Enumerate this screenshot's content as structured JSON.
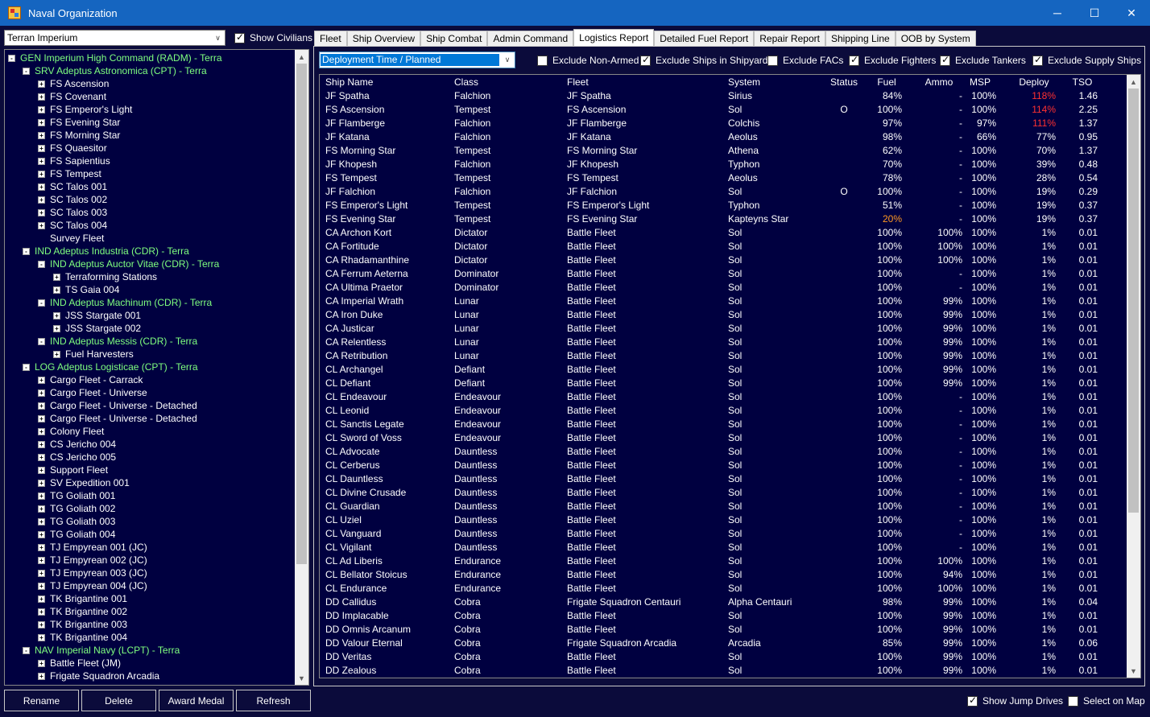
{
  "window": {
    "title": "Naval Organization"
  },
  "race_combo": {
    "value": "Terran Imperium"
  },
  "show_civilians": {
    "label": "Show Civilians",
    "checked": true
  },
  "tree": [
    {
      "label": "GEN Imperium High Command  (RADM)  -  Terra",
      "level": 0,
      "exp": "-",
      "color": "green"
    },
    {
      "label": "SRV Adeptus Astronomica  (CPT)  -  Terra",
      "level": 1,
      "exp": "-",
      "color": "green"
    },
    {
      "label": "FS Ascension",
      "level": 2,
      "exp": "+",
      "color": "white"
    },
    {
      "label": "FS Covenant",
      "level": 2,
      "exp": "+",
      "color": "white"
    },
    {
      "label": "FS Emperor's Light",
      "level": 2,
      "exp": "+",
      "color": "white"
    },
    {
      "label": "FS Evening Star",
      "level": 2,
      "exp": "+",
      "color": "white"
    },
    {
      "label": "FS Morning Star",
      "level": 2,
      "exp": "+",
      "color": "white"
    },
    {
      "label": "FS Quaesitor",
      "level": 2,
      "exp": "+",
      "color": "white"
    },
    {
      "label": "FS Sapientius",
      "level": 2,
      "exp": "+",
      "color": "white"
    },
    {
      "label": "FS Tempest",
      "level": 2,
      "exp": "+",
      "color": "white"
    },
    {
      "label": "SC Talos 001",
      "level": 2,
      "exp": "+",
      "color": "white"
    },
    {
      "label": "SC Talos 002",
      "level": 2,
      "exp": "+",
      "color": "white"
    },
    {
      "label": "SC Talos 003",
      "level": 2,
      "exp": "+",
      "color": "white"
    },
    {
      "label": "SC Talos 004",
      "level": 2,
      "exp": "+",
      "color": "white"
    },
    {
      "label": "Survey Fleet",
      "level": 2,
      "exp": "",
      "color": "white"
    },
    {
      "label": "IND Adeptus Industria  (CDR)  -  Terra",
      "level": 1,
      "exp": "-",
      "color": "green"
    },
    {
      "label": "IND Adeptus Auctor Vitae  (CDR)  -  Terra",
      "level": 2,
      "exp": "-",
      "color": "green"
    },
    {
      "label": "Terraforming Stations",
      "level": 3,
      "exp": "+",
      "color": "white"
    },
    {
      "label": "TS Gaia 004",
      "level": 3,
      "exp": "+",
      "color": "white"
    },
    {
      "label": "IND Adeptus Machinum  (CDR)  -  Terra",
      "level": 2,
      "exp": "-",
      "color": "green"
    },
    {
      "label": "JSS Stargate 001",
      "level": 3,
      "exp": "+",
      "color": "white"
    },
    {
      "label": "JSS Stargate 002",
      "level": 3,
      "exp": "+",
      "color": "white"
    },
    {
      "label": "IND Adeptus Messis  (CDR)  -  Terra",
      "level": 2,
      "exp": "-",
      "color": "green"
    },
    {
      "label": "Fuel Harvesters",
      "level": 3,
      "exp": "+",
      "color": "white"
    },
    {
      "label": "LOG Adeptus Logisticae  (CPT)  -  Terra",
      "level": 1,
      "exp": "-",
      "color": "green"
    },
    {
      "label": "Cargo Fleet - Carrack",
      "level": 2,
      "exp": "+",
      "color": "white"
    },
    {
      "label": "Cargo Fleet - Universe",
      "level": 2,
      "exp": "+",
      "color": "white"
    },
    {
      "label": "Cargo Fleet - Universe - Detached",
      "level": 2,
      "exp": "+",
      "color": "white"
    },
    {
      "label": "Cargo Fleet - Universe - Detached",
      "level": 2,
      "exp": "+",
      "color": "white"
    },
    {
      "label": "Colony Fleet",
      "level": 2,
      "exp": "+",
      "color": "white"
    },
    {
      "label": "CS Jericho 004",
      "level": 2,
      "exp": "+",
      "color": "white"
    },
    {
      "label": "CS Jericho 005",
      "level": 2,
      "exp": "+",
      "color": "white"
    },
    {
      "label": "Support Fleet",
      "level": 2,
      "exp": "+",
      "color": "white"
    },
    {
      "label": "SV Expedition 001",
      "level": 2,
      "exp": "+",
      "color": "white"
    },
    {
      "label": "TG Goliath 001",
      "level": 2,
      "exp": "+",
      "color": "white"
    },
    {
      "label": "TG Goliath 002",
      "level": 2,
      "exp": "+",
      "color": "white"
    },
    {
      "label": "TG Goliath 003",
      "level": 2,
      "exp": "+",
      "color": "white"
    },
    {
      "label": "TG Goliath 004",
      "level": 2,
      "exp": "+",
      "color": "white"
    },
    {
      "label": "TJ Empyrean 001  (JC)",
      "level": 2,
      "exp": "+",
      "color": "white"
    },
    {
      "label": "TJ Empyrean 002  (JC)",
      "level": 2,
      "exp": "+",
      "color": "white"
    },
    {
      "label": "TJ Empyrean 003  (JC)",
      "level": 2,
      "exp": "+",
      "color": "white"
    },
    {
      "label": "TJ Empyrean 004  (JC)",
      "level": 2,
      "exp": "+",
      "color": "white"
    },
    {
      "label": "TK Brigantine 001",
      "level": 2,
      "exp": "+",
      "color": "white"
    },
    {
      "label": "TK Brigantine 002",
      "level": 2,
      "exp": "+",
      "color": "white"
    },
    {
      "label": "TK Brigantine 003",
      "level": 2,
      "exp": "+",
      "color": "white"
    },
    {
      "label": "TK Brigantine 004",
      "level": 2,
      "exp": "+",
      "color": "white"
    },
    {
      "label": "NAV Imperial Navy  (LCPT)  -  Terra",
      "level": 1,
      "exp": "-",
      "color": "green"
    },
    {
      "label": "Battle Fleet  (JM)",
      "level": 2,
      "exp": "+",
      "color": "white"
    },
    {
      "label": "Frigate Squadron Arcadia",
      "level": 2,
      "exp": "+",
      "color": "white"
    }
  ],
  "buttons": {
    "rename": "Rename",
    "delete": "Delete",
    "award_medal": "Award Medal",
    "refresh": "Refresh"
  },
  "tabs": [
    {
      "label": "Fleet",
      "active": false
    },
    {
      "label": "Ship Overview",
      "active": false
    },
    {
      "label": "Ship Combat",
      "active": false
    },
    {
      "label": "Admin Command",
      "active": false
    },
    {
      "label": "Logistics Report",
      "active": true
    },
    {
      "label": "Detailed Fuel Report",
      "active": false
    },
    {
      "label": "Repair Report",
      "active": false
    },
    {
      "label": "Shipping Line",
      "active": false
    },
    {
      "label": "OOB by System",
      "active": false
    }
  ],
  "report_combo": {
    "value": "Deployment Time / Planned"
  },
  "filters": [
    {
      "label": "Exclude Non-Armed",
      "checked": false
    },
    {
      "label": "Exclude Ships in Shipyard",
      "checked": true
    },
    {
      "label": "Exclude FACs",
      "checked": false
    },
    {
      "label": "Exclude Fighters",
      "checked": true
    },
    {
      "label": "Exclude Tankers",
      "checked": true
    },
    {
      "label": "Exclude Supply Ships",
      "checked": true
    }
  ],
  "columns": [
    "Ship Name",
    "Class",
    "Fleet",
    "System",
    "Status",
    "Fuel",
    "Ammo",
    "MSP",
    "Deploy",
    "TSO"
  ],
  "rows": [
    [
      "JF Spatha",
      "Falchion",
      "JF Spatha",
      "Sirius",
      "",
      "84%",
      "-",
      "100%",
      "118%",
      "1.46"
    ],
    [
      "FS Ascension",
      "Tempest",
      "FS Ascension",
      "Sol",
      "O",
      "100%",
      "-",
      "100%",
      "114%",
      "2.25"
    ],
    [
      "JF Flamberge",
      "Falchion",
      "JF Flamberge",
      "Colchis",
      "",
      "97%",
      "-",
      "97%",
      "111%",
      "1.37"
    ],
    [
      "JF Katana",
      "Falchion",
      "JF Katana",
      "Aeolus",
      "",
      "98%",
      "-",
      "66%",
      "77%",
      "0.95"
    ],
    [
      "FS Morning Star",
      "Tempest",
      "FS Morning Star",
      "Athena",
      "",
      "62%",
      "-",
      "100%",
      "70%",
      "1.37"
    ],
    [
      "JF Khopesh",
      "Falchion",
      "JF Khopesh",
      "Typhon",
      "",
      "70%",
      "-",
      "100%",
      "39%",
      "0.48"
    ],
    [
      "FS Tempest",
      "Tempest",
      "FS Tempest",
      "Aeolus",
      "",
      "78%",
      "-",
      "100%",
      "28%",
      "0.54"
    ],
    [
      "JF Falchion",
      "Falchion",
      "JF Falchion",
      "Sol",
      "O",
      "100%",
      "-",
      "100%",
      "19%",
      "0.29"
    ],
    [
      "FS Emperor's Light",
      "Tempest",
      "FS Emperor's Light",
      "Typhon",
      "",
      "51%",
      "-",
      "100%",
      "19%",
      "0.37"
    ],
    [
      "FS Evening Star",
      "Tempest",
      "FS Evening Star",
      "Kapteyns Star",
      "",
      "20%",
      "-",
      "100%",
      "19%",
      "0.37"
    ],
    [
      "CA Archon Kort",
      "Dictator",
      "Battle Fleet",
      "Sol",
      "",
      "100%",
      "100%",
      "100%",
      "1%",
      "0.01"
    ],
    [
      "CA Fortitude",
      "Dictator",
      "Battle Fleet",
      "Sol",
      "",
      "100%",
      "100%",
      "100%",
      "1%",
      "0.01"
    ],
    [
      "CA Rhadamanthine",
      "Dictator",
      "Battle Fleet",
      "Sol",
      "",
      "100%",
      "100%",
      "100%",
      "1%",
      "0.01"
    ],
    [
      "CA Ferrum Aeterna",
      "Dominator",
      "Battle Fleet",
      "Sol",
      "",
      "100%",
      "-",
      "100%",
      "1%",
      "0.01"
    ],
    [
      "CA Ultima Praetor",
      "Dominator",
      "Battle Fleet",
      "Sol",
      "",
      "100%",
      "-",
      "100%",
      "1%",
      "0.01"
    ],
    [
      "CA Imperial Wrath",
      "Lunar",
      "Battle Fleet",
      "Sol",
      "",
      "100%",
      "99%",
      "100%",
      "1%",
      "0.01"
    ],
    [
      "CA Iron Duke",
      "Lunar",
      "Battle Fleet",
      "Sol",
      "",
      "100%",
      "99%",
      "100%",
      "1%",
      "0.01"
    ],
    [
      "CA Justicar",
      "Lunar",
      "Battle Fleet",
      "Sol",
      "",
      "100%",
      "99%",
      "100%",
      "1%",
      "0.01"
    ],
    [
      "CA Relentless",
      "Lunar",
      "Battle Fleet",
      "Sol",
      "",
      "100%",
      "99%",
      "100%",
      "1%",
      "0.01"
    ],
    [
      "CA Retribution",
      "Lunar",
      "Battle Fleet",
      "Sol",
      "",
      "100%",
      "99%",
      "100%",
      "1%",
      "0.01"
    ],
    [
      "CL Archangel",
      "Defiant",
      "Battle Fleet",
      "Sol",
      "",
      "100%",
      "99%",
      "100%",
      "1%",
      "0.01"
    ],
    [
      "CL Defiant",
      "Defiant",
      "Battle Fleet",
      "Sol",
      "",
      "100%",
      "99%",
      "100%",
      "1%",
      "0.01"
    ],
    [
      "CL Endeavour",
      "Endeavour",
      "Battle Fleet",
      "Sol",
      "",
      "100%",
      "-",
      "100%",
      "1%",
      "0.01"
    ],
    [
      "CL Leonid",
      "Endeavour",
      "Battle Fleet",
      "Sol",
      "",
      "100%",
      "-",
      "100%",
      "1%",
      "0.01"
    ],
    [
      "CL Sanctis Legate",
      "Endeavour",
      "Battle Fleet",
      "Sol",
      "",
      "100%",
      "-",
      "100%",
      "1%",
      "0.01"
    ],
    [
      "CL Sword of Voss",
      "Endeavour",
      "Battle Fleet",
      "Sol",
      "",
      "100%",
      "-",
      "100%",
      "1%",
      "0.01"
    ],
    [
      "CL Advocate",
      "Dauntless",
      "Battle Fleet",
      "Sol",
      "",
      "100%",
      "-",
      "100%",
      "1%",
      "0.01"
    ],
    [
      "CL Cerberus",
      "Dauntless",
      "Battle Fleet",
      "Sol",
      "",
      "100%",
      "-",
      "100%",
      "1%",
      "0.01"
    ],
    [
      "CL Dauntless",
      "Dauntless",
      "Battle Fleet",
      "Sol",
      "",
      "100%",
      "-",
      "100%",
      "1%",
      "0.01"
    ],
    [
      "CL Divine Crusade",
      "Dauntless",
      "Battle Fleet",
      "Sol",
      "",
      "100%",
      "-",
      "100%",
      "1%",
      "0.01"
    ],
    [
      "CL Guardian",
      "Dauntless",
      "Battle Fleet",
      "Sol",
      "",
      "100%",
      "-",
      "100%",
      "1%",
      "0.01"
    ],
    [
      "CL Uziel",
      "Dauntless",
      "Battle Fleet",
      "Sol",
      "",
      "100%",
      "-",
      "100%",
      "1%",
      "0.01"
    ],
    [
      "CL Vanguard",
      "Dauntless",
      "Battle Fleet",
      "Sol",
      "",
      "100%",
      "-",
      "100%",
      "1%",
      "0.01"
    ],
    [
      "CL Vigilant",
      "Dauntless",
      "Battle Fleet",
      "Sol",
      "",
      "100%",
      "-",
      "100%",
      "1%",
      "0.01"
    ],
    [
      "CL Ad Liberis",
      "Endurance",
      "Battle Fleet",
      "Sol",
      "",
      "100%",
      "100%",
      "100%",
      "1%",
      "0.01"
    ],
    [
      "CL Bellator Stoicus",
      "Endurance",
      "Battle Fleet",
      "Sol",
      "",
      "100%",
      "94%",
      "100%",
      "1%",
      "0.01"
    ],
    [
      "CL Endurance",
      "Endurance",
      "Battle Fleet",
      "Sol",
      "",
      "100%",
      "100%",
      "100%",
      "1%",
      "0.01"
    ],
    [
      "DD Callidus",
      "Cobra",
      "Frigate Squadron Centauri",
      "Alpha Centauri",
      "",
      "98%",
      "99%",
      "100%",
      "1%",
      "0.04"
    ],
    [
      "DD Implacable",
      "Cobra",
      "Battle Fleet",
      "Sol",
      "",
      "100%",
      "99%",
      "100%",
      "1%",
      "0.01"
    ],
    [
      "DD Omnis Arcanum",
      "Cobra",
      "Battle Fleet",
      "Sol",
      "",
      "100%",
      "99%",
      "100%",
      "1%",
      "0.01"
    ],
    [
      "DD Valour Eternal",
      "Cobra",
      "Frigate Squadron Arcadia",
      "Arcadia",
      "",
      "85%",
      "99%",
      "100%",
      "1%",
      "0.06"
    ],
    [
      "DD Veritas",
      "Cobra",
      "Battle Fleet",
      "Sol",
      "",
      "100%",
      "99%",
      "100%",
      "1%",
      "0.01"
    ],
    [
      "DD Zealous",
      "Cobra",
      "Battle Fleet",
      "Sol",
      "",
      "100%",
      "99%",
      "100%",
      "1%",
      "0.01"
    ]
  ],
  "highlights": {
    "deploy_red": [
      0,
      1,
      2
    ],
    "fuel_orange": [
      9
    ]
  },
  "bottom_options": [
    {
      "label": "Show Jump Drives",
      "checked": true
    },
    {
      "label": "Select on Map",
      "checked": false
    }
  ],
  "colors": {
    "background": "#0b0b3b",
    "titlebar": "#1565c0",
    "tree_group": "#7fff7f",
    "warning_red": "#ff3030",
    "warning_orange": "#ff9922"
  }
}
